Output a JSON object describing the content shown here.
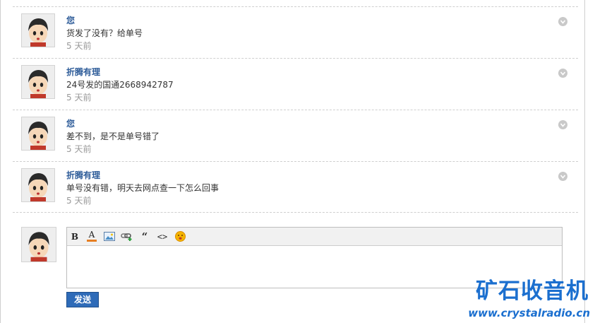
{
  "messages": [
    {
      "author": "您",
      "text": "货发了没有？给单号",
      "time": "5 天前"
    },
    {
      "author": "折腾有理",
      "text": "24号发的国通2668942787",
      "time": "5 天前"
    },
    {
      "author": "您",
      "text": "差不到，是不是单号错了",
      "time": "5 天前"
    },
    {
      "author": "折腾有理",
      "text": "单号没有错，明天去网点查一下怎么回事",
      "time": "5 天前"
    }
  ],
  "editor": {
    "tools": [
      {
        "name": "bold-icon",
        "glyph": "B"
      },
      {
        "name": "font-color-icon",
        "glyph": "A"
      },
      {
        "name": "image-icon",
        "glyph": ""
      },
      {
        "name": "link-icon",
        "glyph": ""
      },
      {
        "name": "quote-icon",
        "glyph": "“"
      },
      {
        "name": "code-icon",
        "glyph": "<>"
      },
      {
        "name": "emoji-icon",
        "glyph": ""
      }
    ],
    "textarea_value": ""
  },
  "send_label": "发送",
  "watermark": {
    "title": "矿石收音机",
    "url": "www.crystalradio.cn"
  },
  "colors": {
    "author": "#2e5c99",
    "send_button": "#2e6bb8",
    "watermark": "#1b6fcf",
    "time": "#999999"
  }
}
